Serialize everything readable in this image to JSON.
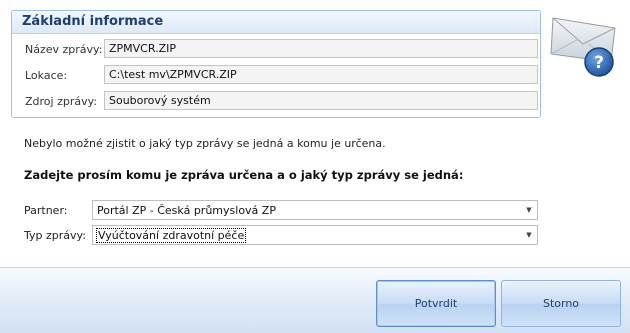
{
  "info_group": {
    "title": "Základní informace",
    "fields": [
      {
        "label": "Název zprávy:",
        "value": "ZPMVCR.ZIP"
      },
      {
        "label": "Lokace:",
        "value": "C:\\test mv\\ZPMVCR.ZIP"
      },
      {
        "label": "Zdroj zprávy:",
        "value": "Souborový systém"
      }
    ]
  },
  "message": {
    "info": "Nebylo možné zjistit o jaký typ zprávy se jedná a komu je určena.",
    "prompt": "Zadejte prosím komu je zpráva určena a o jaký typ zprávy se jedná:"
  },
  "form": {
    "partner": {
      "label": "Partner:",
      "value": "Portál ZP - Česká průmyslová ZP"
    },
    "type": {
      "label": "Typ zprávy:",
      "value": "Vyúčtování zdravotní péče"
    }
  },
  "buttons": {
    "confirm": "Potvrdit",
    "cancel": "Storno"
  },
  "icons": {
    "header_icon": "message-help-icon",
    "dropdown_arrow": "▼"
  },
  "colors": {
    "group_title": "#1e3f73",
    "button_text": "#1e3f73",
    "accent_border": "#9cc0e8"
  }
}
